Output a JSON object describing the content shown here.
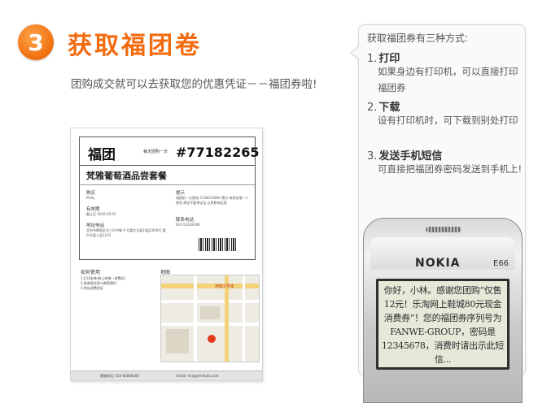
{
  "step": {
    "number": "3",
    "title": "获取福团卷",
    "description": "团购成交就可以去获取您的优惠凭证－－福团券啦!"
  },
  "voucher": {
    "brand": "福团",
    "tagline": "每天团购一次",
    "code": "#77182265",
    "product": "梵雅葡萄酒品尝套餐",
    "buyer_label": "购买",
    "buyer_value": "Philly",
    "validity_label": "有效期",
    "validity_value": "截止至 2010-05-01",
    "address_label": "地址电话",
    "address_value": "北京市朝阳区东三环中路 9 号富尔大厦10层2009号 富尔大厦三层1103",
    "tips_label": "提示",
    "tips_value": "请提前一天致电 5138014800 预约 每券仅限一人使用 建议不要带宝宝,以免影响品酒",
    "contact_label": "联系电话",
    "contact_value": "010-51238168",
    "howto_label": "如何使用",
    "howto_steps": [
      "1.打印本券(券上有唯一消费码)",
      "2.按券面信息与商家预约",
      "3.到店消费验证"
    ],
    "map_label": "地图",
    "map_road_label": "地铁1号线",
    "footer_service": "客服电话: 010-82866285",
    "footer_email": "Email: help@mefuan.com"
  },
  "bubble": {
    "intro": "获取福团券有三种方式:",
    "methods": [
      {
        "num": "1.",
        "title": "打印",
        "desc": "如果身边有打印机，可以直接打印福团券"
      },
      {
        "num": "2.",
        "title": "下载",
        "desc": "设有打印机时，可下载到别处打印"
      },
      {
        "num": "3.",
        "title": "发送手机短信",
        "desc": "可直接把福团券密码发送到手机上!"
      }
    ]
  },
  "phone": {
    "brand": "NOKIA",
    "model": "E66",
    "sms": "你好，小林。感谢您团购“仅售12元！乐淘网上鞋城80元现金消费券”！您的福团券序列号为FANWE-GROUP，密码是12345678，消费时请出示此短信..."
  },
  "colors": {
    "accent": "#f26b0f",
    "screen": "#e4e9d8"
  }
}
